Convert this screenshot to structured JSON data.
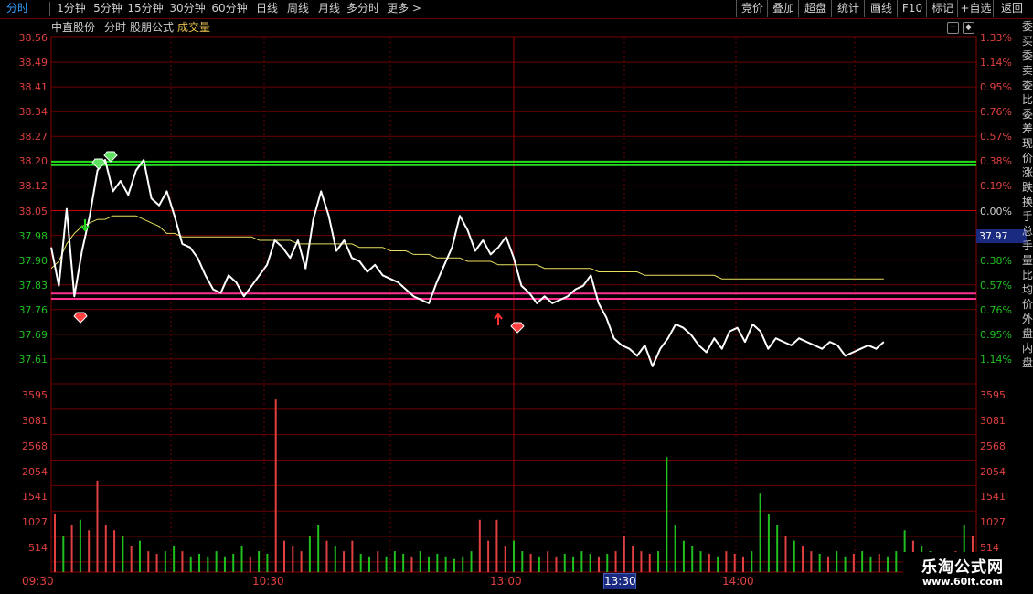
{
  "toolbar": {
    "left_items": [
      {
        "label": "分时",
        "active": true
      },
      {
        "label": "1分钟"
      },
      {
        "label": "5分钟"
      },
      {
        "label": "15分钟"
      },
      {
        "label": "30分钟"
      },
      {
        "label": "60分钟"
      },
      {
        "label": "日线"
      },
      {
        "label": "周线"
      },
      {
        "label": "月线"
      },
      {
        "label": "多分时"
      },
      {
        "label": "更多 >"
      }
    ],
    "right_items": [
      "竞价",
      "叠加",
      "超盘",
      "统计",
      "画线",
      "F10",
      "标记",
      "+自选",
      "返回"
    ]
  },
  "header": {
    "stock_name": "中直股份",
    "mode": "分时",
    "formula": "股朋公式",
    "volume_label": "成交量"
  },
  "price_axis": {
    "left_labels": [
      "38.56",
      "38.49",
      "38.41",
      "38.34",
      "38.27",
      "38.20",
      "38.12",
      "38.05",
      "37.98",
      "37.90",
      "37.83",
      "37.76",
      "37.69",
      "37.61"
    ],
    "right_labels": [
      "1.33%",
      "1.14%",
      "0.95%",
      "0.76%",
      "0.57%",
      "0.38%",
      "0.19%",
      "0.00%",
      "0.19%",
      "0.38%",
      "0.57%",
      "0.76%",
      "0.95%",
      "1.14%"
    ],
    "current_price": "37.97"
  },
  "volume_axis": {
    "labels": [
      "3595",
      "3081",
      "2568",
      "2054",
      "1541",
      "1027",
      "514"
    ]
  },
  "time_axis": {
    "labels": [
      "09:30",
      "10:30",
      "13:00",
      "14:00"
    ],
    "cursor_time": "13:30"
  },
  "side_strip": "委买委卖委比委差现价涨跌换手总手量比均价外盘内盘",
  "watermark": {
    "title": "乐淘公式网",
    "url": "www.60lt.com"
  },
  "colors": {
    "up": "#e04040",
    "down": "#20c020",
    "price_line": "#ffffff",
    "avg_line": "#e8e060",
    "level_green": "#20e020",
    "level_pink": "#ff3090"
  },
  "chart_data": {
    "type": "line",
    "x": [
      "09:30",
      "09:32",
      "09:34",
      "09:36",
      "09:38",
      "09:40",
      "09:42",
      "09:44",
      "09:46",
      "09:48",
      "09:50",
      "09:52",
      "09:54",
      "09:56",
      "09:58",
      "10:00",
      "10:02",
      "10:04",
      "10:06",
      "10:08",
      "10:10",
      "10:12",
      "10:14",
      "10:16",
      "10:18",
      "10:20",
      "10:22",
      "10:24",
      "10:26",
      "10:28",
      "10:30",
      "10:32",
      "10:34",
      "10:36",
      "10:38",
      "10:40",
      "10:42",
      "10:44",
      "10:46",
      "10:48",
      "10:50",
      "10:52",
      "10:54",
      "10:56",
      "10:58",
      "11:00",
      "11:02",
      "11:04",
      "11:06",
      "11:08",
      "11:10",
      "11:12",
      "11:14",
      "11:16",
      "11:18",
      "11:20",
      "11:22",
      "11:24",
      "11:26",
      "11:28",
      "11:30",
      "13:00",
      "13:02",
      "13:04",
      "13:06",
      "13:08",
      "13:10",
      "13:12",
      "13:14",
      "13:16",
      "13:18",
      "13:20",
      "13:22",
      "13:24",
      "13:26",
      "13:28",
      "13:30",
      "13:32",
      "13:34",
      "13:36",
      "13:38",
      "13:40",
      "13:42",
      "13:44",
      "13:46",
      "13:48",
      "13:50",
      "13:52",
      "13:54",
      "13:56",
      "13:58",
      "14:00",
      "14:02",
      "14:04",
      "14:06",
      "14:08",
      "14:10",
      "14:12",
      "14:14",
      "14:16",
      "14:18",
      "14:20",
      "14:22",
      "14:24",
      "14:26",
      "14:28",
      "14:30",
      "14:32",
      "14:34",
      "14:36",
      "14:38",
      "14:40",
      "14:42",
      "14:44",
      "14:46",
      "14:48",
      "14:50",
      "14:52",
      "14:54",
      "14:56",
      "14:58"
    ],
    "series": [
      {
        "values": [
          37.96,
          37.85,
          38.07,
          37.82,
          37.95,
          38.05,
          38.18,
          38.21,
          38.12,
          38.15,
          38.11,
          38.18,
          38.21,
          38.1,
          38.08,
          38.12,
          38.05,
          37.97,
          37.96,
          37.93,
          37.88,
          37.84,
          37.83,
          37.88,
          37.86,
          37.82,
          37.85,
          37.88,
          37.91,
          37.98,
          37.96,
          37.93,
          37.98,
          37.9,
          38.04,
          38.12,
          38.05,
          37.95,
          37.98,
          37.93,
          37.92,
          37.89,
          37.91,
          37.88,
          37.87,
          37.86,
          37.84,
          37.82,
          37.81,
          37.8,
          37.86,
          37.91,
          37.96,
          38.05,
          38.01,
          37.95,
          37.98,
          37.94,
          37.96,
          37.99,
          37.93,
          37.85,
          37.83,
          37.8,
          37.82,
          37.8,
          37.81,
          37.82,
          37.84,
          37.85,
          37.88,
          37.8,
          37.76,
          37.7,
          37.68,
          37.67,
          37.65,
          37.68,
          37.62,
          37.67,
          37.7,
          37.74,
          37.73,
          37.71,
          37.68,
          37.66,
          37.7,
          37.67,
          37.72,
          37.73,
          37.69,
          37.74,
          37.72,
          37.67,
          37.7,
          37.69,
          37.68,
          37.7,
          37.69,
          37.68,
          37.67,
          37.69,
          37.68,
          37.65,
          37.66,
          37.67,
          37.68,
          37.67,
          37.69
        ]
      },
      {
        "values": [
          37.9,
          37.92,
          37.97,
          38.0,
          38.02,
          38.03,
          38.04,
          38.04,
          38.05,
          38.05,
          38.05,
          38.05,
          38.04,
          38.03,
          38.02,
          38.0,
          38.0,
          37.99,
          37.99,
          37.99,
          37.99,
          37.99,
          37.99,
          37.99,
          37.99,
          37.99,
          37.99,
          37.98,
          37.98,
          37.98,
          37.98,
          37.98,
          37.97,
          37.97,
          37.97,
          37.97,
          37.97,
          37.97,
          37.97,
          37.97,
          37.96,
          37.96,
          37.96,
          37.96,
          37.95,
          37.95,
          37.95,
          37.94,
          37.94,
          37.94,
          37.93,
          37.93,
          37.93,
          37.93,
          37.92,
          37.92,
          37.92,
          37.92,
          37.91,
          37.91,
          37.91,
          37.91,
          37.91,
          37.91,
          37.9,
          37.9,
          37.9,
          37.9,
          37.9,
          37.9,
          37.9,
          37.89,
          37.89,
          37.89,
          37.89,
          37.89,
          37.89,
          37.88,
          37.88,
          37.88,
          37.88,
          37.88,
          37.88,
          37.88,
          37.88,
          37.88,
          37.88,
          37.87,
          37.87,
          37.87,
          37.87,
          37.87,
          37.87,
          37.87,
          37.87,
          37.87,
          37.87,
          37.87,
          37.87,
          37.87,
          37.87,
          37.87,
          37.87,
          37.87,
          37.87,
          37.87,
          37.87,
          37.87,
          37.87
        ]
      }
    ],
    "volume": [
      1100,
      700,
      900,
      1000,
      800,
      1750,
      900,
      800,
      700,
      500,
      600,
      400,
      350,
      400,
      500,
      400,
      300,
      350,
      300,
      400,
      300,
      350,
      500,
      300,
      400,
      350,
      3300,
      600,
      500,
      400,
      700,
      900,
      600,
      500,
      400,
      600,
      350,
      300,
      400,
      300,
      400,
      350,
      300,
      400,
      300,
      350,
      300,
      250,
      300,
      400,
      1000,
      600,
      1000,
      500,
      600,
      400,
      350,
      300,
      400,
      300,
      350,
      300,
      400,
      350,
      300,
      350,
      400,
      700,
      500,
      400,
      350,
      400,
      2200,
      900,
      600,
      500,
      400,
      350,
      300,
      400,
      350,
      300,
      400,
      1500,
      1100,
      900,
      700,
      600,
      500,
      400,
      350,
      300,
      400,
      300,
      350,
      400,
      300,
      350,
      300,
      400,
      800,
      600,
      500,
      400,
      350,
      300,
      400,
      900,
      700
    ],
    "title": "",
    "ylim": [
      37.57,
      38.56
    ],
    "volume_ylim": [
      0,
      3600
    ],
    "levels": [
      38.205,
      38.195,
      37.828,
      37.813
    ]
  }
}
